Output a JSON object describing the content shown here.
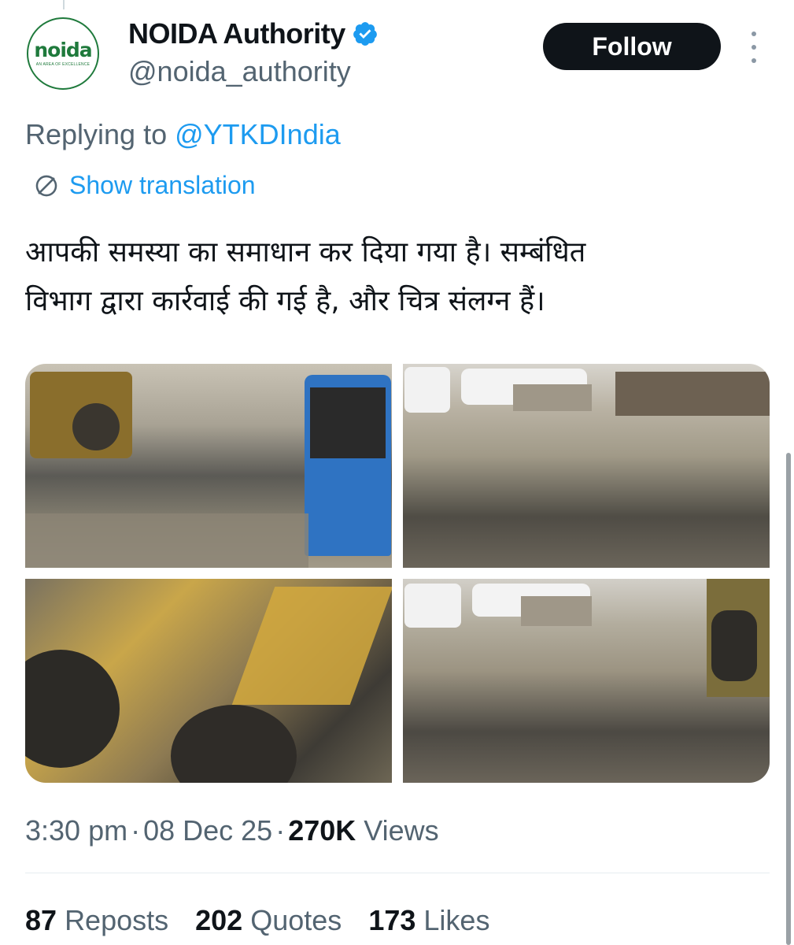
{
  "account": {
    "display_name": "NOIDA Authority",
    "handle": "@noida_authority",
    "verified": true,
    "avatar_logo": "noida",
    "avatar_tagline": "AN AREA OF EXCELLENCE"
  },
  "follow_label": "Follow",
  "reply": {
    "prefix": "Replying to",
    "mention": "@YTKDIndia"
  },
  "translation_label": "Show translation",
  "tweet_text_line1": "आपकी समस्या का समाधान कर दिया गया है। सम्बंधित",
  "tweet_text_line2": "विभाग द्वारा कार्रवाई की गई है, और चित्र संलग्न हैं।",
  "meta": {
    "time": "3:30 pm",
    "date": "08 Dec 25",
    "views_count": "270K",
    "views_label": "Views"
  },
  "stats": {
    "reposts_count": "87",
    "reposts_label": "Reposts",
    "quotes_count": "202",
    "quotes_label": "Quotes",
    "likes_count": "173",
    "likes_label": "Likes"
  },
  "icons": {
    "verified": "verified-badge-icon",
    "more": "more-options-icon",
    "translate": "translate-icon"
  },
  "colors": {
    "accent": "#1d9bf0",
    "follow_bg": "#0f1419",
    "muted": "#536471"
  }
}
